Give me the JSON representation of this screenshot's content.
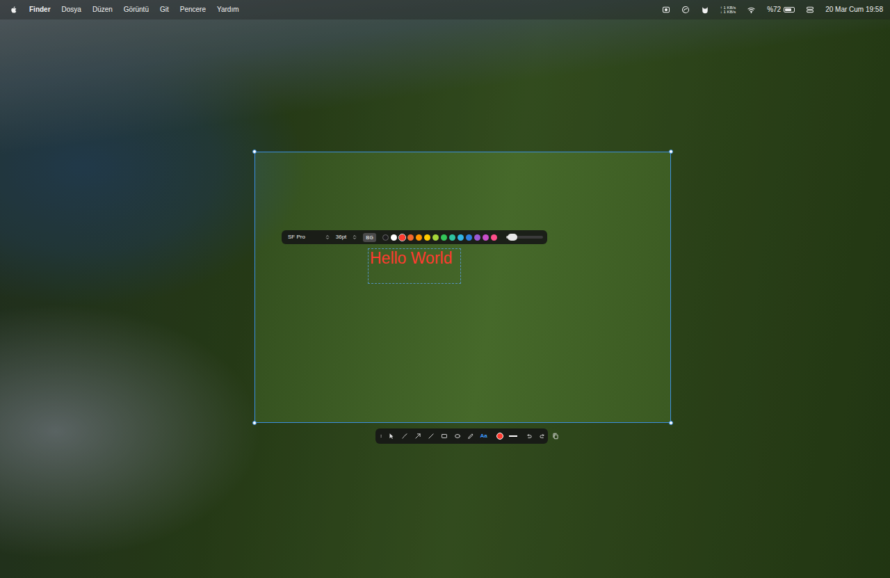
{
  "menubar": {
    "app": "Finder",
    "menus": [
      "Dosya",
      "Düzen",
      "Görüntü",
      "Git",
      "Pencere",
      "Yardım"
    ],
    "network": {
      "up": "↑ 1 KB/s",
      "down": "↓ 1 KB/s"
    },
    "battery": {
      "percent": "%72",
      "level": 0.72
    },
    "clock": "20 Mar Cum 19:58"
  },
  "text_toolbar": {
    "font": "SF Pro",
    "size": "36pt",
    "bg": {
      "label": "BG",
      "selected": false
    },
    "colors": [
      {
        "color": "#1c1c1e",
        "selected": false
      },
      {
        "color": "#ffffff",
        "selected": false
      },
      {
        "color": "#ff3b30",
        "selected": true
      },
      {
        "color": "#f2682c",
        "selected": false
      },
      {
        "color": "#ff9500",
        "selected": false
      },
      {
        "color": "#ffcc00",
        "selected": false
      },
      {
        "color": "#a5d63a",
        "selected": false
      },
      {
        "color": "#34c759",
        "selected": false
      },
      {
        "color": "#2ec4a0",
        "selected": false
      },
      {
        "color": "#32b5e6",
        "selected": false
      },
      {
        "color": "#2f7fe0",
        "selected": false
      },
      {
        "color": "#9b59d6",
        "selected": false
      },
      {
        "color": "#c94fc9",
        "selected": false
      },
      {
        "color": "#ff4f8b",
        "selected": false
      }
    ],
    "opacity": {
      "level": 0.12
    }
  },
  "annotation": {
    "text": "Hello World",
    "color": "#ff3b30",
    "editing": true
  },
  "tools": [
    {
      "kind": "select",
      "selected": false
    },
    {
      "kind": "pen",
      "selected": false
    },
    {
      "kind": "arrow",
      "selected": false
    },
    {
      "kind": "line",
      "selected": false
    },
    {
      "kind": "rect",
      "selected": false
    },
    {
      "kind": "ellipse",
      "selected": false
    },
    {
      "kind": "marker",
      "selected": false
    },
    {
      "kind": "text",
      "label": "Aa",
      "selected": true
    }
  ],
  "stroke": {
    "color": "#ff3b30"
  },
  "actions": [
    {
      "kind": "undo"
    },
    {
      "kind": "redo"
    },
    {
      "kind": "copy"
    }
  ]
}
